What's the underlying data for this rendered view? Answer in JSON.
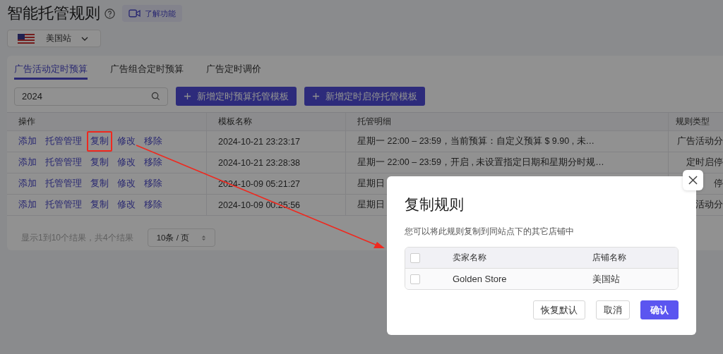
{
  "page": {
    "title": "智能托管规则",
    "learn_button": "了解功能"
  },
  "site_select": {
    "value": "美国站"
  },
  "tabs": [
    {
      "label": "广告活动定时预算",
      "selected": true
    },
    {
      "label": "广告组合定时预算",
      "selected": false
    },
    {
      "label": "广告定时调价",
      "selected": false
    }
  ],
  "search": {
    "value": "2024"
  },
  "action_buttons": [
    "新增定时预算托管模板",
    "新增定时启停托管模板"
  ],
  "table": {
    "columns": [
      "操作",
      "模板名称",
      "托管明细",
      "规则类型"
    ],
    "rows": [
      {
        "actions": [
          {
            "label": "添加",
            "highlighted": false
          },
          {
            "label": "托管管理",
            "highlighted": false
          },
          {
            "label": "复制",
            "highlighted": true
          },
          {
            "label": "修改",
            "highlighted": false
          },
          {
            "label": "移除",
            "highlighted": false
          }
        ],
        "template": "2024-10-21 23:23:17",
        "detail": "星期一  22:00 – 23:59，当前预算：自定义预算 $ 9.90 , 未…",
        "rule_type": "广告活动分"
      },
      {
        "actions": [
          {
            "label": "添加",
            "highlighted": false
          },
          {
            "label": "托管管理",
            "highlighted": false
          },
          {
            "label": "复制",
            "highlighted": false
          },
          {
            "label": "修改",
            "highlighted": false
          },
          {
            "label": "移除",
            "highlighted": false
          }
        ],
        "template": "2024-10-21 23:28:38",
        "detail": "星期一  22:00 – 23:59，开启 , 未设置指定日期和星期分时规…",
        "rule_type": "定时启停"
      },
      {
        "actions": [
          {
            "label": "添加",
            "highlighted": false
          },
          {
            "label": "托管管理",
            "highlighted": false
          },
          {
            "label": "复制",
            "highlighted": false
          },
          {
            "label": "修改",
            "highlighted": false
          },
          {
            "label": "移除",
            "highlighted": false
          }
        ],
        "template": "2024-10-09 05:21:27",
        "detail": "星期日",
        "rule_type": "停"
      },
      {
        "actions": [
          {
            "label": "添加",
            "highlighted": false
          },
          {
            "label": "托管管理",
            "highlighted": false
          },
          {
            "label": "复制",
            "highlighted": false
          },
          {
            "label": "修改",
            "highlighted": false
          },
          {
            "label": "移除",
            "highlighted": false
          }
        ],
        "template": "2024-10-09 00:25:56",
        "detail": "星期日",
        "rule_type": "活动分"
      }
    ]
  },
  "pagination": {
    "summary": "显示1到10个结果，共4个结果",
    "page_size": "10条 / 页"
  },
  "dialog": {
    "title": "复制规则",
    "description": "您可以将此规则复制到同站点下的其它店铺中",
    "columns": [
      "卖家名称",
      "店铺名称"
    ],
    "header_checked": false,
    "rows": [
      {
        "seller": "Golden Store",
        "store": "美国站",
        "checked": false
      }
    ],
    "buttons": [
      {
        "label": "恢复默认",
        "kind": "default"
      },
      {
        "label": "取消",
        "kind": "default"
      },
      {
        "label": "确认",
        "kind": "primary"
      }
    ]
  }
}
